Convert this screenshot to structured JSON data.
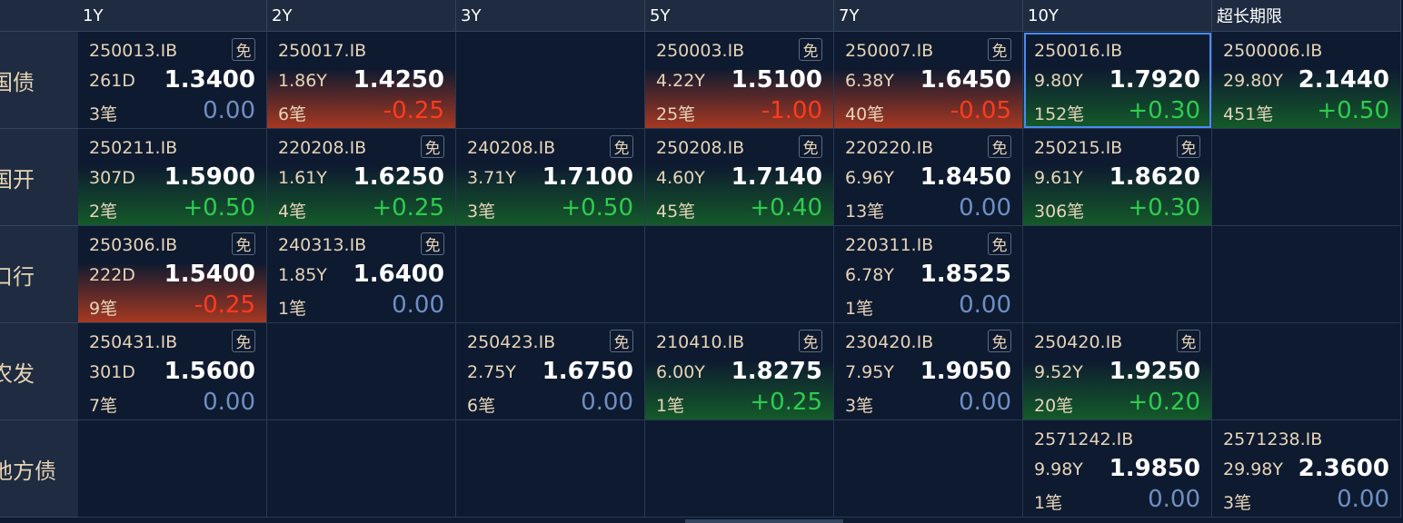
{
  "columns": [
    "1Y",
    "2Y",
    "3Y",
    "5Y",
    "7Y",
    "10Y",
    "超长期限"
  ],
  "rows": [
    {
      "label": "国债",
      "cells": [
        {
          "code": "250013.IB",
          "badge": "免",
          "tenor": "261D",
          "yield": "1.3400",
          "deals": "3笔",
          "change": "0.00",
          "trend": "zero"
        },
        {
          "code": "250017.IB",
          "badge": "",
          "tenor": "1.86Y",
          "yield": "1.4250",
          "deals": "6笔",
          "change": "-0.25",
          "trend": "neg"
        },
        null,
        {
          "code": "250003.IB",
          "badge": "免",
          "tenor": "4.22Y",
          "yield": "1.5100",
          "deals": "25笔",
          "change": "-1.00",
          "trend": "neg"
        },
        {
          "code": "250007.IB",
          "badge": "免",
          "tenor": "6.38Y",
          "yield": "1.6450",
          "deals": "40笔",
          "change": "-0.05",
          "trend": "neg"
        },
        {
          "code": "250016.IB",
          "badge": "",
          "tenor": "9.80Y",
          "yield": "1.7920",
          "deals": "152笔",
          "change": "+0.30",
          "trend": "pos",
          "selected": true
        },
        {
          "code": "2500006.IB",
          "badge": "",
          "tenor": "29.80Y",
          "yield": "2.1440",
          "deals": "451笔",
          "change": "+0.50",
          "trend": "pos"
        }
      ]
    },
    {
      "label": "国开",
      "cells": [
        {
          "code": "250211.IB",
          "badge": "",
          "tenor": "307D",
          "yield": "1.5900",
          "deals": "2笔",
          "change": "+0.50",
          "trend": "pos"
        },
        {
          "code": "220208.IB",
          "badge": "免",
          "tenor": "1.61Y",
          "yield": "1.6250",
          "deals": "4笔",
          "change": "+0.25",
          "trend": "pos"
        },
        {
          "code": "240208.IB",
          "badge": "免",
          "tenor": "3.71Y",
          "yield": "1.7100",
          "deals": "3笔",
          "change": "+0.50",
          "trend": "pos"
        },
        {
          "code": "250208.IB",
          "badge": "免",
          "tenor": "4.60Y",
          "yield": "1.7140",
          "deals": "45笔",
          "change": "+0.40",
          "trend": "pos"
        },
        {
          "code": "220220.IB",
          "badge": "免",
          "tenor": "6.96Y",
          "yield": "1.8450",
          "deals": "13笔",
          "change": "0.00",
          "trend": "zero"
        },
        {
          "code": "250215.IB",
          "badge": "免",
          "tenor": "9.61Y",
          "yield": "1.8620",
          "deals": "306笔",
          "change": "+0.30",
          "trend": "pos"
        },
        null
      ]
    },
    {
      "label": "口行",
      "cells": [
        {
          "code": "250306.IB",
          "badge": "免",
          "tenor": "222D",
          "yield": "1.5400",
          "deals": "9笔",
          "change": "-0.25",
          "trend": "neg"
        },
        {
          "code": "240313.IB",
          "badge": "免",
          "tenor": "1.85Y",
          "yield": "1.6400",
          "deals": "1笔",
          "change": "0.00",
          "trend": "zero"
        },
        null,
        null,
        {
          "code": "220311.IB",
          "badge": "免",
          "tenor": "6.78Y",
          "yield": "1.8525",
          "deals": "1笔",
          "change": "0.00",
          "trend": "zero"
        },
        null,
        null
      ]
    },
    {
      "label": "农发",
      "cells": [
        {
          "code": "250431.IB",
          "badge": "免",
          "tenor": "301D",
          "yield": "1.5600",
          "deals": "7笔",
          "change": "0.00",
          "trend": "zero"
        },
        null,
        {
          "code": "250423.IB",
          "badge": "免",
          "tenor": "2.75Y",
          "yield": "1.6750",
          "deals": "6笔",
          "change": "0.00",
          "trend": "zero"
        },
        {
          "code": "210410.IB",
          "badge": "免",
          "tenor": "6.00Y",
          "yield": "1.8275",
          "deals": "1笔",
          "change": "+0.25",
          "trend": "pos"
        },
        {
          "code": "230420.IB",
          "badge": "免",
          "tenor": "7.95Y",
          "yield": "1.9050",
          "deals": "3笔",
          "change": "0.00",
          "trend": "zero"
        },
        {
          "code": "250420.IB",
          "badge": "免",
          "tenor": "9.52Y",
          "yield": "1.9250",
          "deals": "20笔",
          "change": "+0.20",
          "trend": "pos"
        },
        null
      ]
    },
    {
      "label": "地方债",
      "cells": [
        null,
        null,
        null,
        null,
        null,
        {
          "code": "2571242.IB",
          "badge": "",
          "tenor": "9.98Y",
          "yield": "1.9850",
          "deals": "1笔",
          "change": "0.00",
          "trend": "zero"
        },
        {
          "code": "2571238.IB",
          "badge": "",
          "tenor": "29.98Y",
          "yield": "2.3600",
          "deals": "3笔",
          "change": "0.00",
          "trend": "zero"
        }
      ]
    }
  ]
}
